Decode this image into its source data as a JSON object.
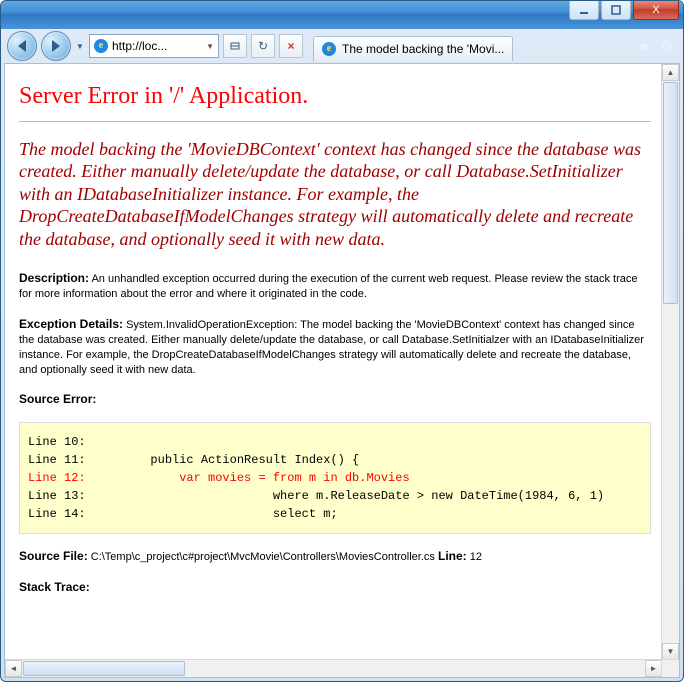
{
  "window": {
    "minimize": "▁",
    "maximize": "▢",
    "close": "X"
  },
  "toolbar": {
    "url_display": "http://loc...",
    "favicon_letter": "e",
    "search_icon": "🔍",
    "refresh_icon": "↻",
    "stop_icon": "×"
  },
  "tab": {
    "favicon_letter": "e",
    "title": "The model backing the 'Movi..."
  },
  "commandbar": {
    "home": "⌂",
    "favorites": "★",
    "tools": "⚙"
  },
  "error": {
    "heading": "Server Error in '/' Application.",
    "summary": "The model backing the 'MovieDBContext' context has changed since the database was created. Either manually delete/update the database, or call Database.SetInitializer with an IDatabaseInitializer instance. For example, the DropCreateDatabaseIfModelChanges strategy will automatically delete and recreate the database, and optionally seed it with new data.",
    "description_label": "Description:",
    "description_text": " An unhandled exception occurred during the execution of the current web request. Please review the stack trace for more information about the error and where it originated in the code.",
    "exception_label": "Exception Details:",
    "exception_text": " System.InvalidOperationException: The model backing the 'MovieDBContext' context has changed since the database was created. Either manually delete/update the database, or call Database.SetInitialzer with an IDatabaseInitializer instance. For example, the DropCreateDatabaseIfModelChanges strategy will automatically delete and recreate the database, and optionally seed it with new data.",
    "source_error_label": "Source Error:",
    "code": {
      "l10": "Line 10:",
      "l11": "Line 11:         public ActionResult Index() {",
      "l12": "Line 12:             var movies = from m in db.Movies",
      "l13": "Line 13:                          where m.ReleaseDate > new DateTime(1984, 6, 1)",
      "l14": "Line 14:                          select m;"
    },
    "source_file_label": "Source File:",
    "source_file_value": " C:\\Temp\\c_project\\c#project\\MvcMovie\\Controllers\\MoviesController.cs",
    "line_label": "    Line:",
    "line_value": " 12",
    "stack_trace_label": "Stack Trace:"
  }
}
